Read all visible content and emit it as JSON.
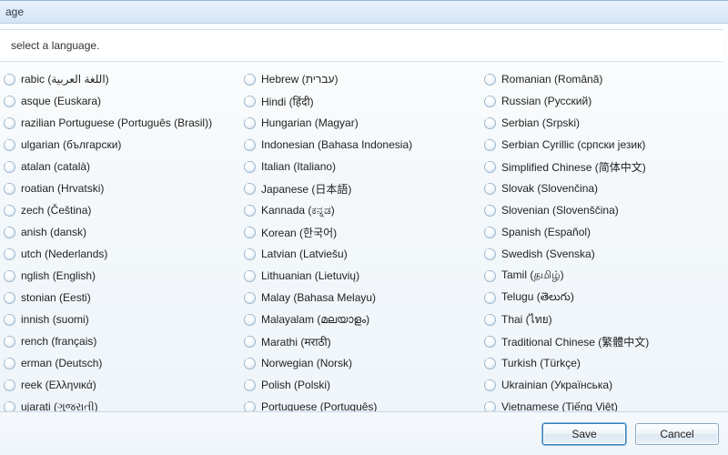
{
  "title_suffix": "age",
  "instruction": "select a language.",
  "buttons": {
    "save": "Save",
    "cancel": "Cancel"
  },
  "columns": [
    [
      "rabic (اللغة العربية)",
      "asque (Euskara)",
      "razilian Portuguese (Português (Brasil))",
      "ulgarian (български)",
      "atalan (català)",
      "roatian (Hrvatski)",
      "zech (Čeština)",
      "anish (dansk)",
      "utch (Nederlands)",
      "nglish (English)",
      "stonian (Eesti)",
      "innish (suomi)",
      "rench (français)",
      "erman (Deutsch)",
      "reek (Ελληνικά)",
      "ujarati (ગુજરાતી)"
    ],
    [
      "Hebrew (עברית)",
      "Hindi (हिंदी)",
      "Hungarian (Magyar)",
      "Indonesian (Bahasa Indonesia)",
      "Italian (Italiano)",
      "Japanese (日本語)",
      "Kannada (ಕನ್ನಡ)",
      "Korean (한국어)",
      "Latvian (Latviešu)",
      "Lithuanian (Lietuvių)",
      "Malay (Bahasa Melayu)",
      "Malayalam (മലയാളം)",
      "Marathi (मराठी)",
      "Norwegian (Norsk)",
      "Polish (Polski)",
      "Portuguese (Português)"
    ],
    [
      "Romanian (Română)",
      "Russian (Русский)",
      "Serbian (Srpski)",
      "Serbian Cyrillic (српски језик)",
      "Simplified Chinese (简体中文)",
      "Slovak (Slovenčina)",
      "Slovenian (Slovenščina)",
      "Spanish (Español)",
      "Swedish (Svenska)",
      "Tamil (தமிழ்)",
      "Telugu (తెలుగు)",
      "Thai (ไทย)",
      "Traditional Chinese (繁體中文)",
      "Turkish (Türkçe)",
      "Ukrainian (Українська)",
      "Vietnamese (Tiếng Việt)"
    ]
  ]
}
